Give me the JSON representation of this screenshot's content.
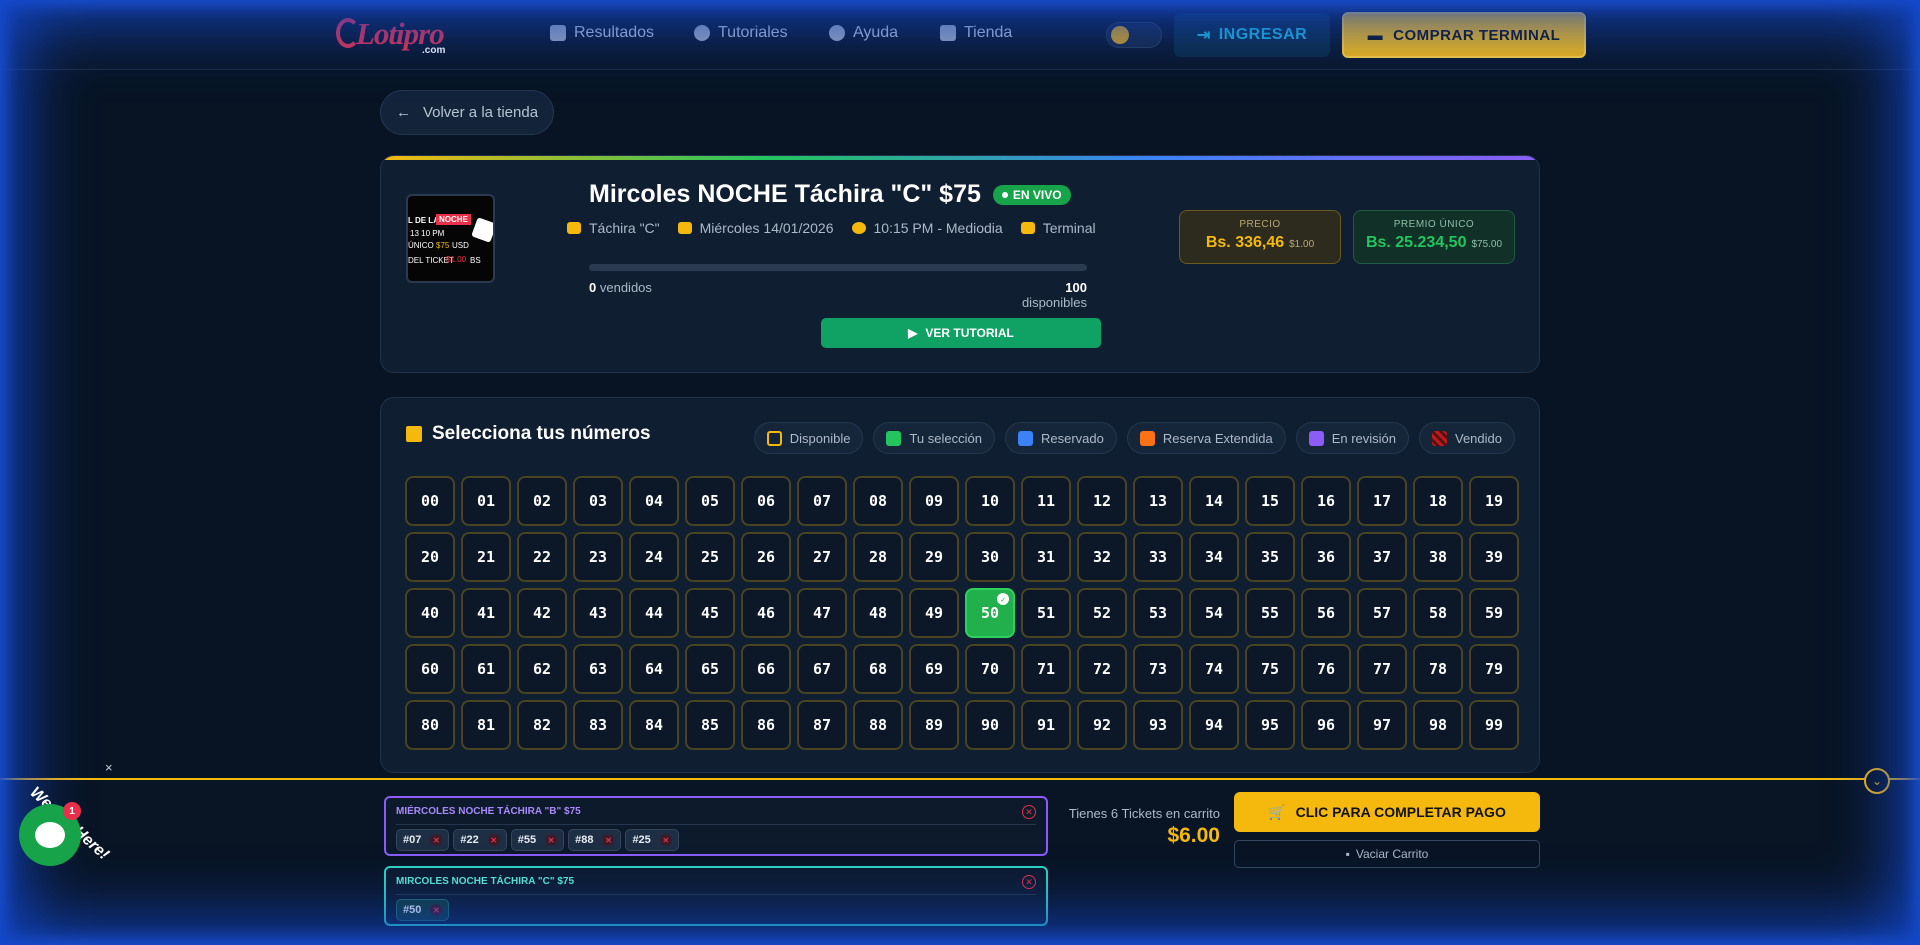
{
  "header": {
    "logo": "Lotipro",
    "logo_sub": ".com",
    "nav": [
      "Resultados",
      "Tutoriales",
      "Ayuda",
      "Tienda"
    ],
    "login_label": "INGRESAR",
    "buy_terminal_label": "COMPRAR TERMINAL"
  },
  "back_label": "Volver a la tienda",
  "raffle": {
    "title": "Mircoles NOCHE Táchira \"C\" $75",
    "status": "EN VIVO",
    "meta": [
      "Táchira \"C\"",
      "Miércoles 14/01/2026",
      "10:15 PM - Mediodia",
      "Terminal"
    ],
    "sold_count": "0",
    "sold_label": "vendidos",
    "available_count": "100",
    "available_label": "disponibles",
    "sold_fraction": 0,
    "tutorial_label": "VER TUTORIAL",
    "thumb_lines": [
      "L DE LA",
      "NOCHE",
      "13 10 PM",
      "ÚNICO",
      "$75",
      "USD",
      "DEL TICKET",
      "$1.00",
      "BS"
    ],
    "price": {
      "label": "PRECIO",
      "value": "Bs. 336,46",
      "usd": "$1.00"
    },
    "prize": {
      "label": "PREMIO ÚNICO",
      "value": "Bs. 25.234,50",
      "usd": "$75.00"
    }
  },
  "selector": {
    "heading": "Selecciona tus números",
    "legend": [
      {
        "label": "Disponible",
        "color": "#f5b90e"
      },
      {
        "label": "Tu selección",
        "color": "#22c55e"
      },
      {
        "label": "Reservado",
        "color": "#3b82f6"
      },
      {
        "label": "Reserva Extendida",
        "color": "#f97316"
      },
      {
        "label": "En revisión",
        "color": "#8b5cf6"
      },
      {
        "label": "Vendido",
        "color": "#b91c1c"
      }
    ],
    "selected": [
      "50"
    ]
  },
  "cart": {
    "groups": [
      {
        "name": "MIÉRCOLES NOCHE TÁCHIRA \"B\" $75",
        "numbers": [
          "#07",
          "#22",
          "#55",
          "#88",
          "#25"
        ]
      },
      {
        "name": "MIRCOLES NOCHE TÁCHIRA \"C\" $75",
        "numbers": [
          "#50"
        ]
      }
    ],
    "count_text": "Tienes 6 Tickets en carrito",
    "total": "$6.00",
    "pay_label": "CLIC PARA COMPLETAR PAGO",
    "empty_label": "Vaciar Carrito"
  },
  "chat": {
    "badge": "1",
    "tagline": "We Are Here!",
    "close": "×"
  }
}
